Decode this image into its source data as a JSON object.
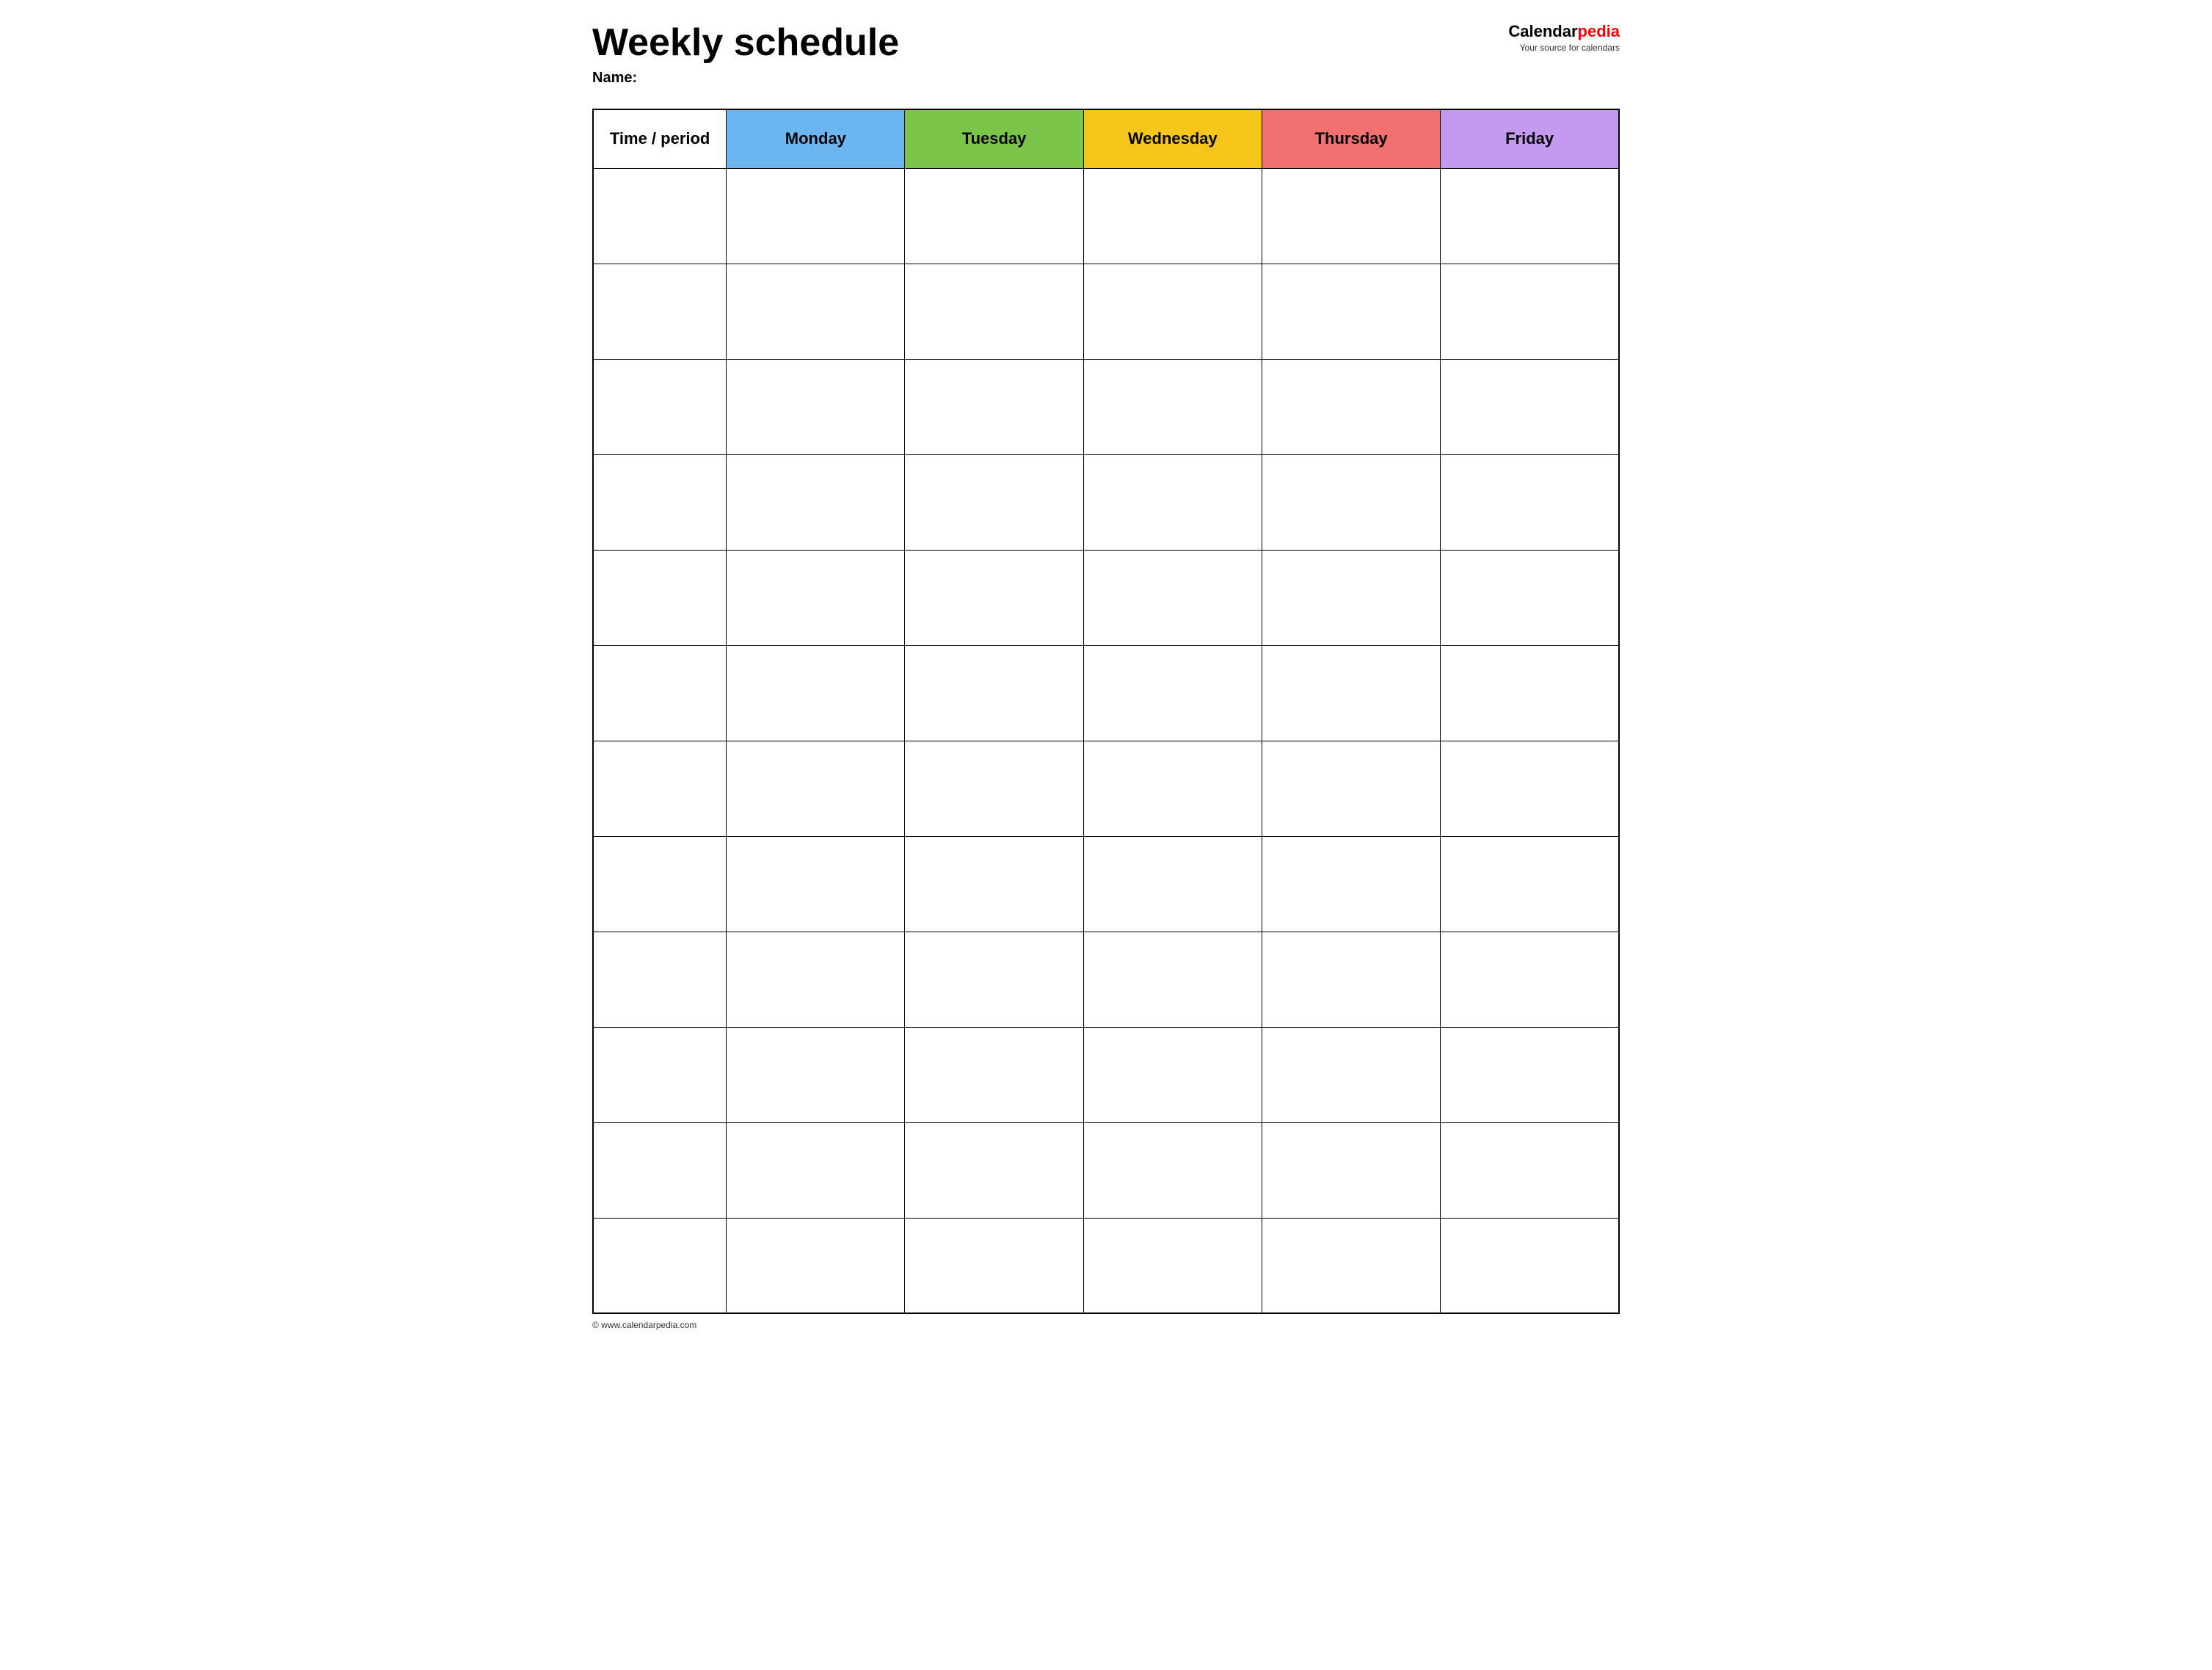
{
  "header": {
    "title": "Weekly schedule",
    "name_label": "Name:",
    "logo": {
      "calendar_part": "Calendar",
      "pedia_part": "pedia",
      "tagline": "Your source for calendars"
    }
  },
  "table": {
    "columns": [
      {
        "id": "time",
        "label": "Time / period",
        "color": "#ffffff"
      },
      {
        "id": "monday",
        "label": "Monday",
        "color": "#6bb5f0"
      },
      {
        "id": "tuesday",
        "label": "Tuesday",
        "color": "#7bc44a"
      },
      {
        "id": "wednesday",
        "label": "Wednesday",
        "color": "#f5c518"
      },
      {
        "id": "thursday",
        "label": "Thursday",
        "color": "#f07070"
      },
      {
        "id": "friday",
        "label": "Friday",
        "color": "#c49af0"
      }
    ],
    "row_count": 12
  },
  "footer": {
    "url": "© www.calendarpedia.com"
  }
}
